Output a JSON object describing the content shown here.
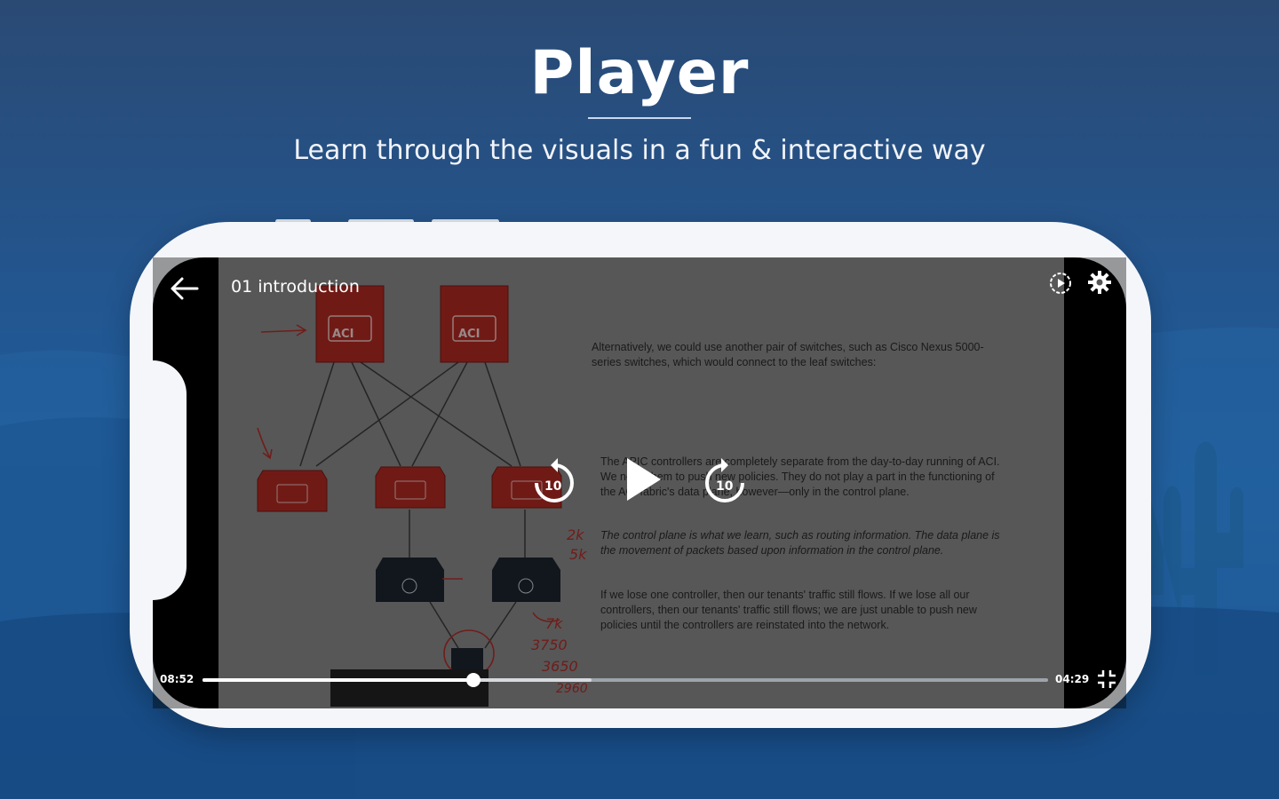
{
  "header": {
    "title": "Player",
    "subtitle": "Learn through the visuals in a fun & interactive way"
  },
  "player": {
    "video_title": "01 introduction",
    "current_time": "08:52",
    "duration": "04:29",
    "progress_fraction": 0.32,
    "buffer_fraction": 0.46,
    "rewind_seconds": "10",
    "forward_seconds": "10"
  },
  "slide": {
    "node_label": "ACI",
    "paragraph_1": "Alternatively, we could use another pair of switches, such as Cisco Nexus 5000-series switches, which would connect to the leaf switches:",
    "paragraph_2": "The APIC controllers are completely separate from the day-to-day running of ACI. We need them to push new policies. They do not play a part in the functioning of the ACI fabric's data plane, however—only in the control plane.",
    "paragraph_3": "The control plane is what we learn, such as routing information. The data plane is the movement of packets based upon information in the control plane.",
    "paragraph_4": "If we lose one controller, then our tenants' traffic still flows. If we lose all our controllers, then our tenants' traffic still flows; we are just unable to push new policies until the controllers are reinstated into the network.",
    "annotations": [
      "2k",
      "5k",
      "7k",
      "3750",
      "3650",
      "2960"
    ]
  },
  "colors": {
    "accent": "#ffffff",
    "aci_red": "#b52a24",
    "background": "#1f5a99"
  },
  "icons": [
    "back-arrow-icon",
    "speed-icon",
    "gear-icon",
    "rewind-10-icon",
    "play-icon",
    "forward-10-icon",
    "exit-fullscreen-icon"
  ]
}
